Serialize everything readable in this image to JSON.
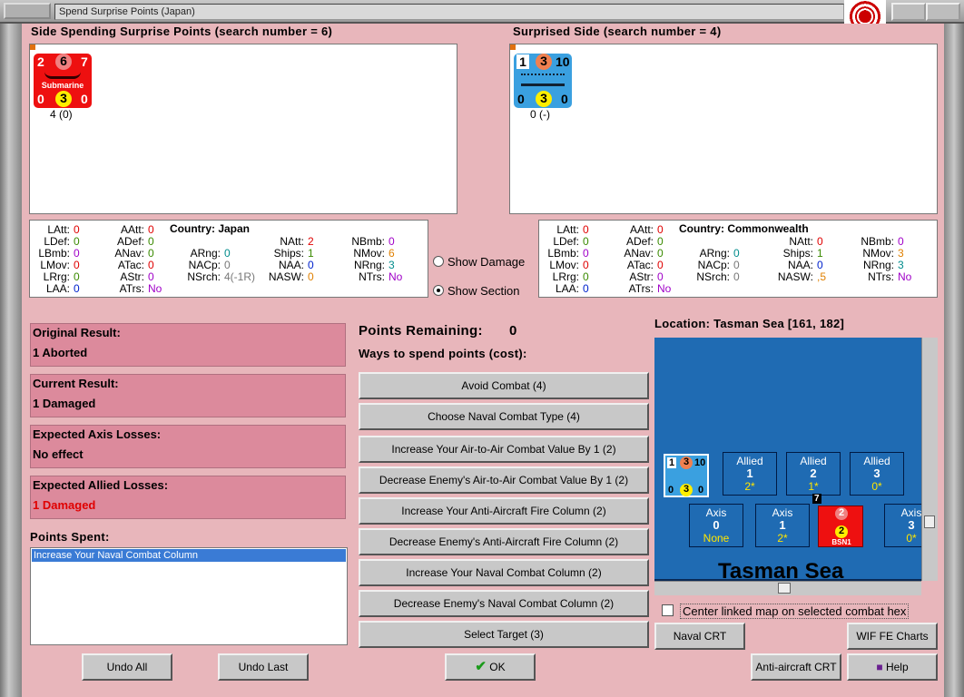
{
  "window": {
    "title": "Spend Surprise Points (Japan)"
  },
  "left_panel": {
    "header": "Side Spending Surprise Points (search number = 6)",
    "counter": {
      "tl": "2",
      "tm": "6",
      "tr": "7",
      "name": "Submarine",
      "bl": "0",
      "bm": "3",
      "br": "0",
      "caption": "4 (0)"
    },
    "stats": {
      "country": "Country: Japan",
      "col1": [
        [
          "LAtt:",
          "0"
        ],
        [
          "LDef:",
          "0"
        ],
        [
          "LBmb:",
          "0"
        ],
        [
          "LMov:",
          "0"
        ],
        [
          "LRrg:",
          "0"
        ],
        [
          "LAA:",
          "0"
        ]
      ],
      "col2": [
        [
          "AAtt:",
          "0"
        ],
        [
          "ADef:",
          "0"
        ],
        [
          "ANav:",
          "0"
        ],
        [
          "ATac:",
          "0"
        ],
        [
          "AStr:",
          "0"
        ],
        [
          "ATrs:",
          "No"
        ]
      ],
      "col3": [
        [
          "ARng:",
          "0"
        ],
        [
          "NACp:",
          "0"
        ],
        [
          "NSrch:",
          "4(-1R)"
        ]
      ],
      "col4": [
        [
          "NAtt:",
          "2"
        ],
        [
          "Ships:",
          "1"
        ],
        [
          "NAA:",
          "0"
        ],
        [
          "NASW:",
          "0"
        ]
      ],
      "col5": [
        [
          "NBmb:",
          "0"
        ],
        [
          "NMov:",
          "6"
        ],
        [
          "NRng:",
          "3"
        ],
        [
          "NTrs:",
          "No"
        ]
      ]
    }
  },
  "right_panel": {
    "header": "Surprised Side (search number = 4)",
    "counter": {
      "tl": "1",
      "tm": "3",
      "tr": "10",
      "bl": "0",
      "bm": "3",
      "br": "0",
      "caption": "0 (-)"
    },
    "stats": {
      "country": "Country: Commonwealth",
      "col1": [
        [
          "LAtt:",
          "0"
        ],
        [
          "LDef:",
          "0"
        ],
        [
          "LBmb:",
          "0"
        ],
        [
          "LMov:",
          "0"
        ],
        [
          "LRrg:",
          "0"
        ],
        [
          "LAA:",
          "0"
        ]
      ],
      "col2": [
        [
          "AAtt:",
          "0"
        ],
        [
          "ADef:",
          "0"
        ],
        [
          "ANav:",
          "0"
        ],
        [
          "ATac:",
          "0"
        ],
        [
          "AStr:",
          "0"
        ],
        [
          "ATrs:",
          "No"
        ]
      ],
      "col3": [
        [
          "ARng:",
          "0"
        ],
        [
          "NACp:",
          "0"
        ],
        [
          "NSrch:",
          "0"
        ]
      ],
      "col4": [
        [
          "NAtt:",
          "0"
        ],
        [
          "Ships:",
          "1"
        ],
        [
          "NAA:",
          "0"
        ],
        [
          "NASW:",
          ",5"
        ]
      ],
      "col5": [
        [
          "NBmb:",
          "0"
        ],
        [
          "NMov:",
          "3"
        ],
        [
          "NRng:",
          "3"
        ],
        [
          "NTrs:",
          "No"
        ]
      ]
    }
  },
  "radios": {
    "show_damage": "Show Damage",
    "show_section": "Show Section",
    "selected": "show_section"
  },
  "results": [
    {
      "title": "Original Result:",
      "value": "1 Aborted",
      "color": "#000000"
    },
    {
      "title": "Current Result:",
      "value": "1 Damaged",
      "color": "#000000"
    },
    {
      "title": "Expected Axis Losses:",
      "value": "No effect",
      "color": "#000000"
    },
    {
      "title": "Expected Allied Losses:",
      "value": "1 Damaged",
      "color": "#e00000"
    }
  ],
  "points_spent": {
    "label": "Points Spent:",
    "items": [
      "Increase Your Naval Combat Column"
    ]
  },
  "points_remaining": {
    "label": "Points Remaining:",
    "value": "0"
  },
  "ways_label": "Ways to spend points (cost):",
  "spend_buttons": [
    "Avoid Combat (4)",
    "Choose Naval Combat Type (4)",
    "Increase Your Air-to-Air Combat Value By 1 (2)",
    "Decrease Enemy's Air-to-Air Combat Value By 1 (2)",
    "Increase Your Anti-Aircraft Fire Column (2)",
    "Decrease Enemy's Anti-Aircraft Fire Column (2)",
    "Increase Your Naval Combat Column (2)",
    "Decrease Enemy's Naval Combat Column (2)",
    "Select Target (3)"
  ],
  "location": "Location: Tasman Sea [161, 182]",
  "map": {
    "sea_name": "Tasman Sea",
    "allied": [
      {
        "label": "Allied",
        "num": "1",
        "val": "2*"
      },
      {
        "label": "Allied",
        "num": "2",
        "val": "1*"
      },
      {
        "label": "Allied",
        "num": "3",
        "val": "0*"
      }
    ],
    "axis": [
      {
        "label": "Axis",
        "num": "0",
        "val": "None"
      },
      {
        "label": "Axis",
        "num": "1",
        "val": "2*"
      },
      {
        "label": "Axis",
        "num": "3",
        "val": "0*"
      }
    ],
    "unit_stack": "7",
    "jp_unit": {
      "top": "2",
      "bottom": "2",
      "name": "BSN1"
    },
    "cw_unit": {
      "tl": "1",
      "tm": "3",
      "tr": "10",
      "bl": "0",
      "bm": "3",
      "br": "0"
    }
  },
  "center_checkbox": "Center linked map on selected combat hex",
  "buttons": {
    "naval_crt": "Naval CRT",
    "wif_fe": "WIF FE Charts",
    "undo_all": "Undo All",
    "undo_last": "Undo Last",
    "ok": "OK",
    "aa_crt": "Anti-aircraft CRT",
    "help": "Help"
  }
}
